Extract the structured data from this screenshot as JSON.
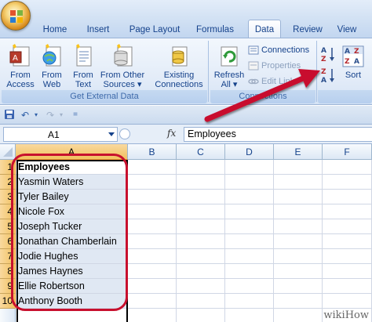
{
  "tabs": [
    {
      "label": "Home",
      "active": false
    },
    {
      "label": "Insert",
      "active": false
    },
    {
      "label": "Page Layout",
      "active": false
    },
    {
      "label": "Formulas",
      "active": false
    },
    {
      "label": "Data",
      "active": true
    },
    {
      "label": "Review",
      "active": false
    },
    {
      "label": "View",
      "active": false
    }
  ],
  "ribbon": {
    "get_external_data": {
      "label": "Get External Data",
      "buttons": [
        {
          "line1": "From",
          "line2": "Access",
          "icon": "access-icon"
        },
        {
          "line1": "From",
          "line2": "Web",
          "icon": "web-icon"
        },
        {
          "line1": "From",
          "line2": "Text",
          "icon": "text-file-icon"
        },
        {
          "line1": "From Other",
          "line2": "Sources ▾",
          "icon": "other-sources-icon"
        },
        {
          "line1": "Existing",
          "line2": "Connections",
          "icon": "existing-connections-icon"
        }
      ]
    },
    "connections": {
      "label": "Connections",
      "refresh_line1": "Refresh",
      "refresh_line2": "All ▾",
      "connections_label": "Connections",
      "properties_label": "Properties",
      "edit_links_label": "Edit Links"
    },
    "sort": {
      "sort_label": "Sort",
      "az_icon": "sort-a-to-z-icon",
      "za_icon": "sort-z-to-a-icon"
    }
  },
  "formula_bar": {
    "name_box": "A1",
    "fx": "fx",
    "value": "Employees"
  },
  "columns": [
    "A",
    "B",
    "C",
    "D",
    "E",
    "F"
  ],
  "rows": [
    {
      "num": "1",
      "a": "Employees"
    },
    {
      "num": "2",
      "a": "Yasmin Waters"
    },
    {
      "num": "3",
      "a": "Tyler Bailey"
    },
    {
      "num": "4",
      "a": "Nicole Fox"
    },
    {
      "num": "5",
      "a": "Joseph Tucker"
    },
    {
      "num": "6",
      "a": "Jonathan Chamberlain"
    },
    {
      "num": "7",
      "a": "Jodie Hughes"
    },
    {
      "num": "8",
      "a": "James Haynes"
    },
    {
      "num": "9",
      "a": "Ellie Robertson"
    },
    {
      "num": "10",
      "a": "Anthony Booth"
    }
  ],
  "watermark": "wikiHow",
  "colors": {
    "annotation_red": "#c8102e",
    "selection_orange": "#f1c15f",
    "ribbon_blue": "#15428b"
  }
}
